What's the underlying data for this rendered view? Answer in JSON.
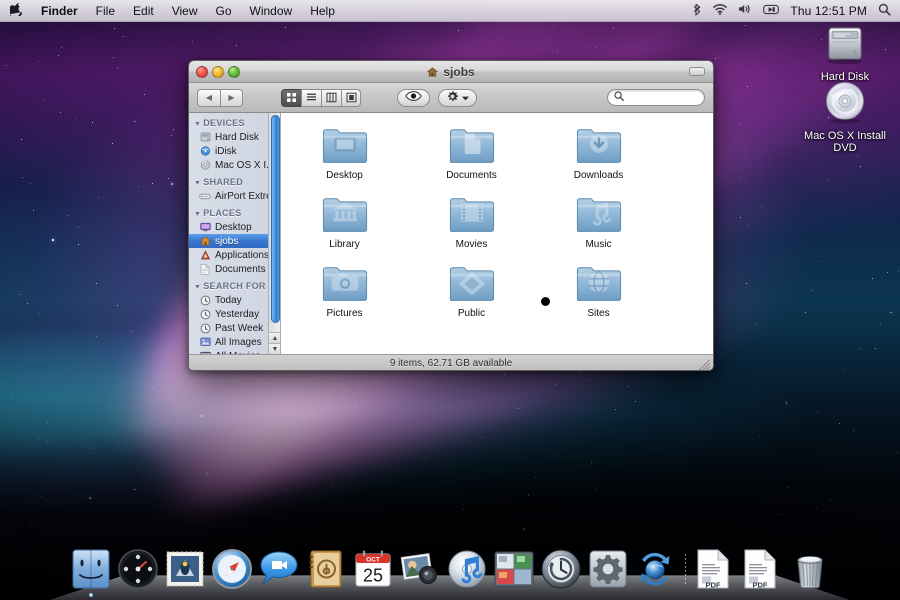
{
  "menubar": {
    "apple_glyph": "",
    "items": [
      {
        "label": "Finder",
        "bold": true
      },
      {
        "label": "File",
        "bold": false
      },
      {
        "label": "Edit",
        "bold": false
      },
      {
        "label": "View",
        "bold": false
      },
      {
        "label": "Go",
        "bold": false
      },
      {
        "label": "Window",
        "bold": false
      },
      {
        "label": "Help",
        "bold": false
      }
    ],
    "status_icons": [
      "bluetooth-icon",
      "wifi-icon",
      "volume-icon",
      "display-icon"
    ],
    "clock": "Thu 12:51 PM",
    "spotlight": "search-icon"
  },
  "desktop_icons": [
    {
      "name": "Hard Disk",
      "icon": "hard-disk-icon"
    },
    {
      "name": "Mac OS X Install DVD",
      "icon": "optical-disc-icon"
    }
  ],
  "finder": {
    "title": "sjobs",
    "title_icon": "home-icon",
    "traffic_lights": [
      "close",
      "minimize",
      "zoom"
    ],
    "toolbar": {
      "back_label": "◀",
      "forward_label": "▶",
      "views": [
        {
          "name": "icon-view",
          "active": true
        },
        {
          "name": "list-view",
          "active": false
        },
        {
          "name": "column-view",
          "active": false
        },
        {
          "name": "coverflow-view",
          "active": false
        }
      ],
      "quicklook_label": "quick-look-eye-icon",
      "action_label": "action-gear-icon",
      "search_value": "",
      "search_placeholder": ""
    },
    "sidebar": [
      {
        "header": "DEVICES",
        "items": [
          {
            "label": "Hard Disk",
            "icon": "hard-disk-icon",
            "selected": false,
            "eject": false
          },
          {
            "label": "iDisk",
            "icon": "idisk-icon",
            "selected": false,
            "eject": false
          },
          {
            "label": "Mac OS X I...",
            "icon": "disc-icon",
            "selected": false,
            "eject": true
          }
        ]
      },
      {
        "header": "SHARED",
        "items": [
          {
            "label": "AirPort Extreme",
            "icon": "airport-icon",
            "selected": false,
            "eject": false
          }
        ]
      },
      {
        "header": "PLACES",
        "items": [
          {
            "label": "Desktop",
            "icon": "desktop-icon",
            "selected": false,
            "eject": false
          },
          {
            "label": "sjobs",
            "icon": "home-icon",
            "selected": true,
            "eject": false
          },
          {
            "label": "Applications",
            "icon": "applications-icon",
            "selected": false,
            "eject": false
          },
          {
            "label": "Documents",
            "icon": "documents-icon",
            "selected": false,
            "eject": false
          }
        ]
      },
      {
        "header": "SEARCH FOR",
        "items": [
          {
            "label": "Today",
            "icon": "clock-icon",
            "selected": false,
            "eject": false
          },
          {
            "label": "Yesterday",
            "icon": "clock-icon",
            "selected": false,
            "eject": false
          },
          {
            "label": "Past Week",
            "icon": "clock-icon",
            "selected": false,
            "eject": false
          },
          {
            "label": "All Images",
            "icon": "images-icon",
            "selected": false,
            "eject": false
          },
          {
            "label": "All Movies",
            "icon": "movies-icon",
            "selected": false,
            "eject": false
          }
        ]
      }
    ],
    "files": [
      {
        "name": "Desktop",
        "glyph": "desktop"
      },
      {
        "name": "Documents",
        "glyph": "document"
      },
      {
        "name": "Downloads",
        "glyph": "download"
      },
      {
        "name": "Library",
        "glyph": "library"
      },
      {
        "name": "Movies",
        "glyph": "film"
      },
      {
        "name": "Music",
        "glyph": "note"
      },
      {
        "name": "Pictures",
        "glyph": "camera"
      },
      {
        "name": "Public",
        "glyph": "dropbox"
      },
      {
        "name": "Sites",
        "glyph": "globe"
      }
    ],
    "status": "9 items, 62.71 GB available"
  },
  "dock": {
    "items": [
      {
        "name": "Finder",
        "icon": "finder-icon",
        "running": true
      },
      {
        "name": "Dashboard",
        "icon": "dashboard-icon",
        "running": false
      },
      {
        "name": "Mail",
        "icon": "mail-icon",
        "running": false
      },
      {
        "name": "Safari",
        "icon": "safari-icon",
        "running": false
      },
      {
        "name": "iChat",
        "icon": "ichat-icon",
        "running": false
      },
      {
        "name": "Address Book",
        "icon": "address-book-icon",
        "running": false
      },
      {
        "name": "iCal",
        "icon": "ical-icon",
        "running": false
      },
      {
        "name": "iPhoto",
        "icon": "iphoto-icon",
        "running": false
      },
      {
        "name": "iTunes",
        "icon": "itunes-icon",
        "running": false
      },
      {
        "name": "Spaces",
        "icon": "spaces-icon",
        "running": false
      },
      {
        "name": "Time Machine",
        "icon": "time-machine-icon",
        "running": false
      },
      {
        "name": "System Preferences",
        "icon": "system-preferences-icon",
        "running": false
      },
      {
        "name": "Software Update",
        "icon": "software-update-icon",
        "running": false
      }
    ],
    "documents": [
      {
        "name": "PDF Document",
        "icon": "pdf-icon",
        "badge": "PDF"
      },
      {
        "name": "PDF Document",
        "icon": "pdf-icon",
        "badge": "PDF"
      }
    ],
    "trash": {
      "name": "Trash",
      "icon": "trash-icon"
    },
    "ical_month": "OCT",
    "ical_day": "25"
  }
}
